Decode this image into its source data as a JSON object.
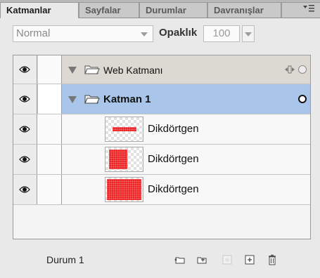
{
  "tabs": [
    {
      "label": "Katmanlar",
      "active": true
    },
    {
      "label": "Sayfalar",
      "active": false
    },
    {
      "label": "Durumlar",
      "active": false
    },
    {
      "label": "Davranışlar",
      "active": false
    }
  ],
  "blend": {
    "value": "Normal"
  },
  "opacity": {
    "label": "Opaklık",
    "value": "100"
  },
  "layers": [
    {
      "name": "Web Katmanı",
      "kind": "web-layer",
      "expanded": true
    },
    {
      "name": "Katman 1",
      "kind": "folder",
      "expanded": true,
      "selected": true
    },
    {
      "name": "Dikdörtgen",
      "kind": "object",
      "thumbnail": "red-bar"
    },
    {
      "name": "Dikdörtgen",
      "kind": "object",
      "thumbnail": "red-square"
    },
    {
      "name": "Dikdörtgen",
      "kind": "object",
      "thumbnail": "red-full"
    }
  ],
  "footer": {
    "status": "Durum 1",
    "buttons": [
      "new-sublayer-icon",
      "new-layer-icon",
      "add-mask-icon",
      "duplicate-layer-icon",
      "delete-trash-icon"
    ]
  },
  "colors": {
    "selection": "#a9c6ea",
    "web_row": "#dcd8d2",
    "shape_red": "#ee2222"
  }
}
